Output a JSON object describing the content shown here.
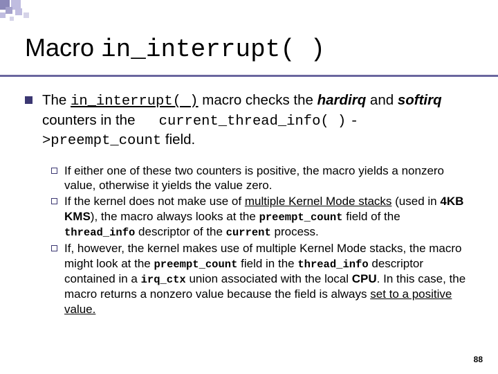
{
  "title": {
    "prefix": "Macro ",
    "code": "in_interrupt( )"
  },
  "para": {
    "t1": "The ",
    "code1": "in_interrupt( )",
    "t2": " macro checks the ",
    "hardirq": "hardirq",
    "t3": " and ",
    "softirq": "softirq",
    "t4": " counters in the ",
    "code2": "current_thread_info( )",
    "code3": "->preempt_count",
    "t5": " field."
  },
  "bullets": [
    {
      "parts": [
        {
          "k": "plain",
          "v": "If either one of these two counters is positive, the macro yields a nonzero value, otherwise it yields the value zero."
        }
      ]
    },
    {
      "parts": [
        {
          "k": "plain",
          "v": "If the kernel does not make use of "
        },
        {
          "k": "u",
          "v": "multiple Kernel Mode stacks"
        },
        {
          "k": "plain",
          "v": " (used in "
        },
        {
          "k": "b",
          "v": "4KB KMS"
        },
        {
          "k": "plain",
          "v": "), the macro always looks at the "
        },
        {
          "k": "mono-b",
          "v": "preempt_count"
        },
        {
          "k": "plain",
          "v": " field of the "
        },
        {
          "k": "mono-b",
          "v": "thread_info"
        },
        {
          "k": "plain",
          "v": " descriptor of the "
        },
        {
          "k": "mono-b",
          "v": "current"
        },
        {
          "k": "plain",
          "v": " process."
        }
      ]
    },
    {
      "parts": [
        {
          "k": "plain",
          "v": "If, however, the kernel makes use of multiple Kernel Mode stacks, the macro might look at the "
        },
        {
          "k": "mono-b",
          "v": "preempt_count"
        },
        {
          "k": "plain",
          "v": " field in the "
        },
        {
          "k": "mono-b",
          "v": "thread_info"
        },
        {
          "k": "plain",
          "v": " descriptor contained in a "
        },
        {
          "k": "mono-b",
          "v": "irq_ctx"
        },
        {
          "k": "plain",
          "v": " union associated with the local "
        },
        {
          "k": "b",
          "v": "CPU"
        },
        {
          "k": "plain",
          "v": ". In this case, the macro returns a nonzero value because the field is always "
        },
        {
          "k": "u",
          "v": "set to a positive value."
        }
      ]
    }
  ],
  "slide_number": "88"
}
